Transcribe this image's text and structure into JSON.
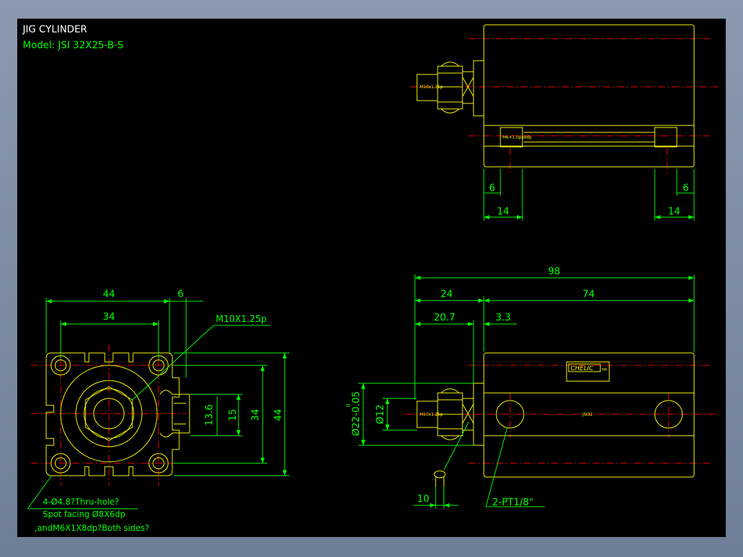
{
  "drawing": {
    "title": "JIG  CYLINDER",
    "model": "Model:  JSI  32X25-B-S"
  },
  "front_view": {
    "dim_44_top": "44",
    "dim_6_top": "6",
    "dim_34_top": "34",
    "dim_13_6": "13.6",
    "dim_15": "15",
    "dim_34_right": "34",
    "dim_44_right": "44",
    "thread_callout": "M10X1.25p",
    "hole_note_1": "4-Ø4.8?Thru-hole?",
    "hole_note_2": "Spot  facing  Ø8X6dp",
    "hole_note_3": ",andM6X1X8dp?Both  sides?"
  },
  "top_view": {
    "rod_thread_label": "M10x1.25p",
    "bore_label": "M6×1.0px8dp",
    "dim_6_left": "6",
    "dim_6_right": "6",
    "dim_14_left": "14",
    "dim_14_right": "14"
  },
  "side_view": {
    "dim_98": "98",
    "dim_24": "24",
    "dim_74": "74",
    "dim_20_7": "20.7",
    "dim_3_3": "3.3",
    "dim_phi22": "Ø22-0.05",
    "dim_phi22_tol": "0",
    "dim_phi12": "Ø12",
    "dim_10": "10",
    "port_callout": "2-PT1/8\"",
    "rod_thread_label": "M10x1.25p",
    "body_label": "JSI32",
    "brand_label": "CHELIC",
    "brand_suffix": "TM"
  },
  "colors": {
    "green": "#00ff00",
    "yellow": "#ffff00",
    "red": "#ff0000",
    "white": "#ffffff",
    "background": "#000000"
  }
}
